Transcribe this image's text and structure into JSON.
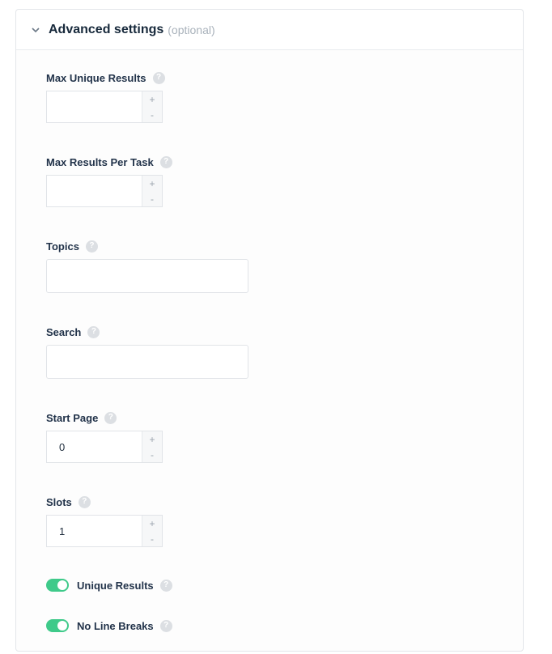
{
  "header": {
    "title": "Advanced settings",
    "optional": "(optional)"
  },
  "fields": {
    "max_unique_results": {
      "label": "Max Unique Results",
      "value": ""
    },
    "max_results_per_task": {
      "label": "Max Results Per Task",
      "value": ""
    },
    "topics": {
      "label": "Topics",
      "value": ""
    },
    "search": {
      "label": "Search",
      "value": ""
    },
    "start_page": {
      "label": "Start Page",
      "value": "0"
    },
    "slots": {
      "label": "Slots",
      "value": "1"
    }
  },
  "toggles": {
    "unique_results": {
      "label": "Unique Results",
      "on": true
    },
    "no_line_breaks": {
      "label": "No Line Breaks",
      "on": true
    }
  },
  "ui": {
    "help_glyph": "?",
    "plus_glyph": "+",
    "minus_glyph": "-"
  },
  "colors": {
    "toggle_on": "#3fca8a",
    "help_bg": "#dcdfe3"
  }
}
